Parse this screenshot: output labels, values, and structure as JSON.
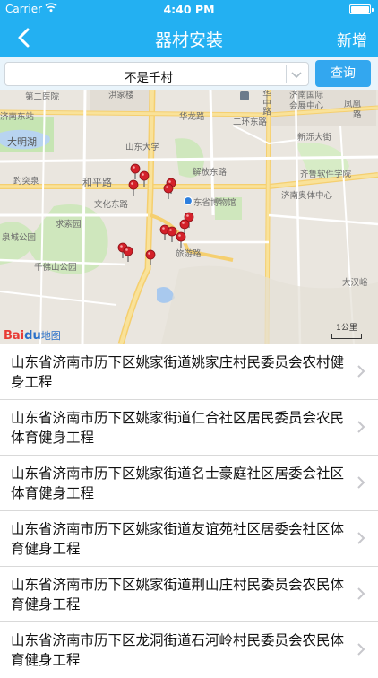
{
  "status_bar": {
    "carrier": "Carrier",
    "time": "4:40 PM",
    "wifi_icon": "wifi-icon",
    "battery_icon": "battery-icon"
  },
  "nav": {
    "back_icon": "chevron-left-icon",
    "title": "器材安装",
    "add_label": "新增"
  },
  "filter": {
    "selected": "不是千村",
    "dropdown_icon": "chevron-down-icon",
    "query_label": "查询"
  },
  "map": {
    "labels": [
      "第二医院",
      "洪家楼",
      "济南国际",
      "会展中心",
      "凤凰",
      "路",
      "济南东站",
      "华龙路",
      "二环东路",
      "大明湖",
      "山东大学",
      "新泺大街",
      "齐鲁软件学院",
      "趵突泉",
      "和平路",
      "解放东路",
      "文化东路",
      "东省博物馆",
      "济南奥体中心",
      "求索园",
      "泉城公园",
      "旅游路",
      "千佛山公园",
      "大汉峪",
      "华中路"
    ],
    "scale_label": "1公里",
    "logo_text_a": "Bai",
    "logo_text_b": "du",
    "logo_text_c": "地图",
    "colors": {
      "road": "#ffffff",
      "major_road": "#f7d47e",
      "park": "#c6e5b3",
      "water": "#a9c9ee",
      "pin": "#d4212a"
    }
  },
  "items": [
    {
      "title": "山东省济南市历下区姚家街道姚家庄村民委员会农村健身工程"
    },
    {
      "title": "山东省济南市历下区姚家街道仁合社区居民委员会农民体育健身工程"
    },
    {
      "title": "山东省济南市历下区姚家街道名士豪庭社区居委会社区体育健身工程"
    },
    {
      "title": "山东省济南市历下区姚家街道友谊苑社区居委会社区体育健身工程"
    },
    {
      "title": "山东省济南市历下区姚家街道荆山庄村民委员会农民体育健身工程"
    },
    {
      "title": "山东省济南市历下区龙洞街道石河岭村民委员会农民体育健身工程"
    }
  ],
  "row_arrow_icon": "chevron-right-icon"
}
